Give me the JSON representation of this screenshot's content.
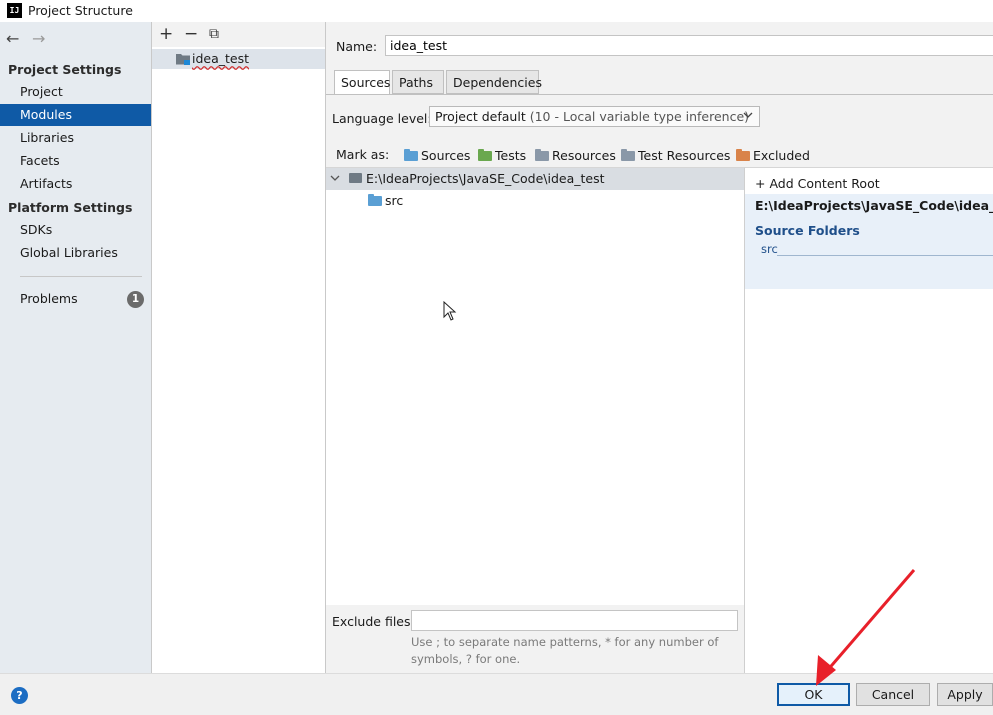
{
  "window": {
    "title": "Project Structure",
    "app_icon": "IJ"
  },
  "nav": {
    "back_icon": "←",
    "forward_icon": "→",
    "sections": [
      {
        "heading": "Project Settings",
        "items": [
          "Project",
          "Modules",
          "Libraries",
          "Facets",
          "Artifacts"
        ]
      },
      {
        "heading": "Platform Settings",
        "items": [
          "SDKs",
          "Global Libraries"
        ]
      }
    ],
    "selected": "Modules",
    "problems": {
      "label": "Problems",
      "count": "1"
    }
  },
  "module_list": {
    "add_icon": "+",
    "remove_icon": "−",
    "copy_icon": "⧉",
    "modules": [
      {
        "name": "idea_test"
      }
    ]
  },
  "module": {
    "name_label": "Name:",
    "name_value": "idea_test",
    "tabs": [
      "Sources",
      "Paths",
      "Dependencies"
    ],
    "active_tab": "Sources",
    "language_level_label": "Language level:",
    "language_level_value": "Project default",
    "language_level_detail": "(10 - Local variable type inference)",
    "mark_as_label": "Mark as:",
    "mark_as": [
      {
        "label": "Sources",
        "color": "#5a9fd4"
      },
      {
        "label": "Tests",
        "color": "#6aa84f"
      },
      {
        "label": "Resources",
        "color": "#8a98a8"
      },
      {
        "label": "Test Resources",
        "color": "#8a98a8"
      },
      {
        "label": "Excluded",
        "color": "#d9834a"
      }
    ],
    "tree": {
      "root": "E:\\IdeaProjects\\JavaSE_Code\\idea_test",
      "children": [
        "src"
      ]
    },
    "content_root": {
      "add_label": "+ Add Content Root",
      "path": "E:\\IdeaProjects\\JavaSE_Code\\idea_test",
      "source_folders_title": "Source Folders",
      "source_folders": [
        "src"
      ]
    },
    "exclude_files_label": "Exclude files:",
    "exclude_files_value": "",
    "exclude_hint": "Use ; to separate name patterns, * for any number of symbols, ? for one."
  },
  "footer": {
    "help_icon": "?",
    "ok_label": "OK",
    "cancel_label": "Cancel",
    "apply_label": "Apply"
  },
  "colors": {
    "selection": "#0f5aa6",
    "annotation_arrow": "#e8202a",
    "folder_gray": "#6f7a84",
    "folder_blue": "#5a9fd4"
  }
}
